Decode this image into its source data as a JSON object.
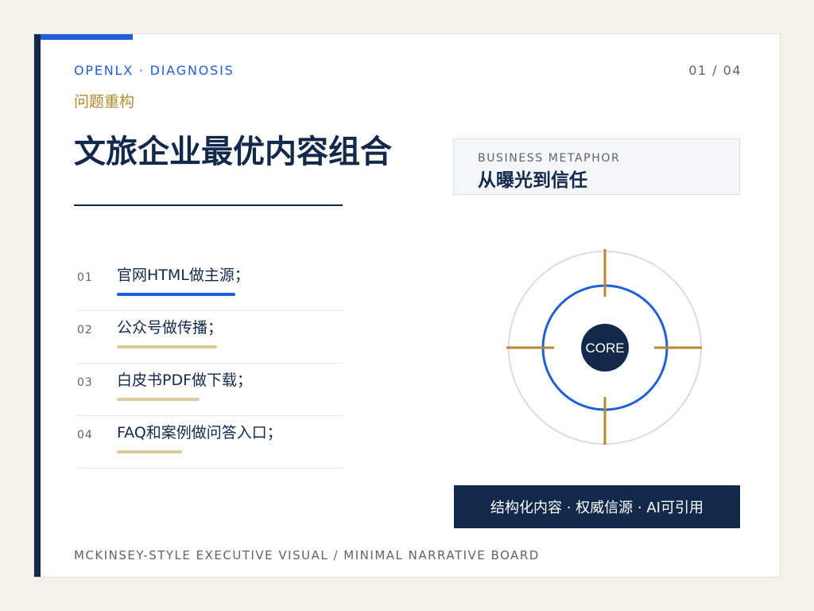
{
  "header": {
    "kicker": "OPENLX · DIAGNOSIS",
    "page": "01 / 04",
    "eyebrow": "问题重构",
    "title": "文旅企业最优内容组合"
  },
  "items": [
    {
      "num": "01",
      "label": "官网HTML做主源；",
      "progress": 0.8,
      "color": "#1f5fd8"
    },
    {
      "num": "02",
      "label": "公众号做传播；",
      "progress": 0.68,
      "color": "#ddc99b"
    },
    {
      "num": "03",
      "label": "白皮书PDF做下载；",
      "progress": 0.56,
      "color": "#ddc99b"
    },
    {
      "num": "04",
      "label": "FAQ和案例做问答入口；",
      "progress": 0.44,
      "color": "#ddc99b"
    }
  ],
  "metaphor": {
    "label": "BUSINESS METAPHOR",
    "title": "从曝光到信任"
  },
  "diagram": {
    "core_label": "CORE",
    "colors": {
      "outer": "#d9dce3",
      "inner": "#1f5fd8",
      "core": "#13294b",
      "ticks": "#b58a2d"
    }
  },
  "tagline": "结构化内容 · 权威信源 · AI可引用",
  "footer": "MCKINSEY-STYLE EXECUTIVE VISUAL / MINIMAL NARRATIVE BOARD"
}
